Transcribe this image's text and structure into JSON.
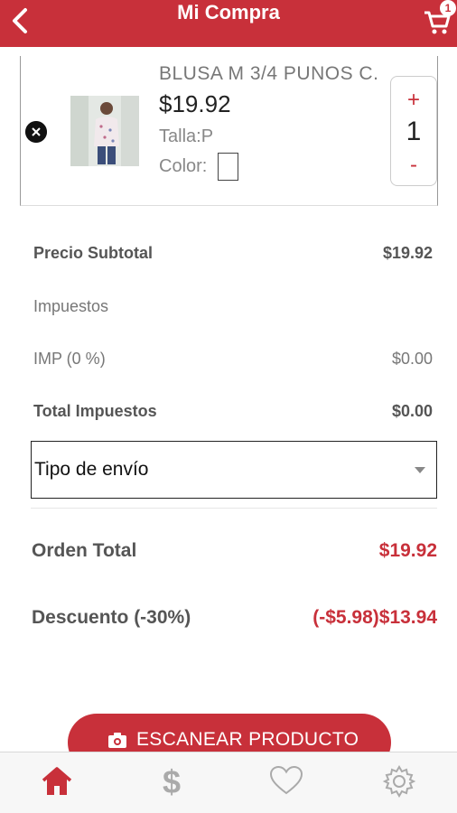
{
  "header": {
    "title": "Mi Compra",
    "cart_badge": "1"
  },
  "colors": {
    "brand": "#c8303a",
    "tab_inactive": "#aaaaaa"
  },
  "cart_item": {
    "name": "BLUSA M 3/4 PUNOS C.",
    "price": "$19.92",
    "size": "Talla:P",
    "color_label": "Color:",
    "quantity": "1",
    "plus": "+",
    "minus": "-"
  },
  "summary": {
    "subtotal_label": "Precio Subtotal",
    "subtotal_value": "$19.92",
    "taxes_label": "Impuestos",
    "tax_line_label": "IMP (0 %)",
    "tax_line_value": "$0.00",
    "total_taxes_label": "Total Impuestos",
    "total_taxes_value": "$0.00"
  },
  "shipping": {
    "selected": "Tipo de envío"
  },
  "totals": {
    "order_total_label": "Orden Total",
    "order_total_value": "$19.92",
    "discount_label": "Descuento (-30%)",
    "discount_value": "(-$5.98)$13.94"
  },
  "scan_button": {
    "label": "ESCANEAR PRODUCTO"
  },
  "tabbar": {
    "tabs": [
      {
        "icon": "home-icon",
        "active": true
      },
      {
        "icon": "dollar-icon",
        "active": false
      },
      {
        "icon": "heart-icon",
        "active": false
      },
      {
        "icon": "gear-icon",
        "active": false
      }
    ]
  }
}
